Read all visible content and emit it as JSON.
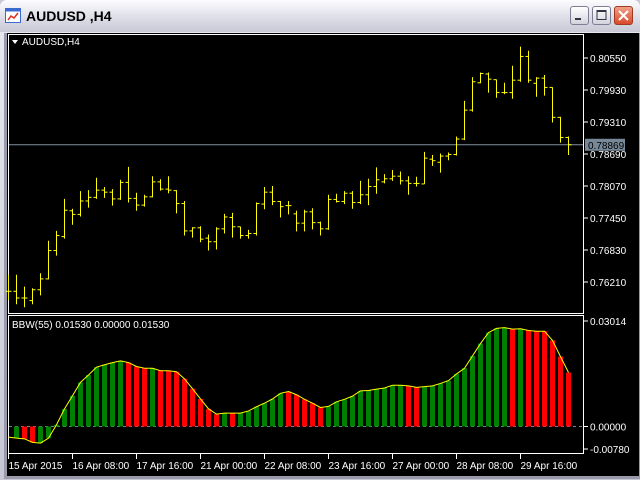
{
  "window": {
    "title": "AUDUSD ,H4"
  },
  "chart": {
    "symbol_label": "AUDUSD,H4",
    "price_axis": [
      "0.80550",
      "0.79930",
      "0.79310",
      "0.78690",
      "0.78070",
      "0.77450",
      "0.76830",
      "0.76210"
    ],
    "price_axis_values": [
      0.8055,
      0.7993,
      0.7931,
      0.7869,
      0.7807,
      0.7745,
      0.7683,
      0.7621
    ],
    "current_price": "0.78869",
    "current_price_value": 0.78869,
    "time_axis": [
      "15 Apr 2015",
      "16 Apr 08:00",
      "17 Apr 16:00",
      "21 Apr 00:00",
      "22 Apr 08:00",
      "23 Apr 16:00",
      "27 Apr 00:00",
      "28 Apr 08:00",
      "29 Apr 16:00"
    ],
    "colors": {
      "bars": "#ffff00",
      "up": "#008000",
      "down": "#ff0000",
      "line": "#ffff00",
      "price_line": "#8090a0"
    },
    "ohlc": [
      [
        0.7603,
        0.7635,
        0.7586,
        0.7603
      ],
      [
        0.7603,
        0.7635,
        0.7578,
        0.759
      ],
      [
        0.759,
        0.7612,
        0.7572,
        0.759
      ],
      [
        0.7585,
        0.7609,
        0.7578,
        0.7606
      ],
      [
        0.7606,
        0.7638,
        0.7595,
        0.7627
      ],
      [
        0.7627,
        0.7701,
        0.7626,
        0.7682
      ],
      [
        0.7682,
        0.772,
        0.7672,
        0.7711
      ],
      [
        0.7709,
        0.7782,
        0.7705,
        0.776
      ],
      [
        0.7759,
        0.7763,
        0.7732,
        0.7752
      ],
      [
        0.7752,
        0.7797,
        0.7748,
        0.7778
      ],
      [
        0.7778,
        0.7799,
        0.7765,
        0.7785
      ],
      [
        0.7785,
        0.7823,
        0.7782,
        0.7799
      ],
      [
        0.7799,
        0.7805,
        0.7784,
        0.7795
      ],
      [
        0.7795,
        0.7801,
        0.7769,
        0.7782
      ],
      [
        0.7782,
        0.7819,
        0.778,
        0.7814
      ],
      [
        0.7814,
        0.7844,
        0.7775,
        0.7783
      ],
      [
        0.7783,
        0.7794,
        0.7759,
        0.777
      ],
      [
        0.777,
        0.779,
        0.7767,
        0.7786
      ],
      [
        0.7786,
        0.7826,
        0.7785,
        0.7815
      ],
      [
        0.7815,
        0.782,
        0.7798,
        0.7801
      ],
      [
        0.7801,
        0.7826,
        0.7793,
        0.7799
      ],
      [
        0.7798,
        0.7799,
        0.7754,
        0.7773
      ],
      [
        0.7773,
        0.7778,
        0.7711,
        0.772
      ],
      [
        0.772,
        0.7727,
        0.7707,
        0.7726
      ],
      [
        0.7726,
        0.7729,
        0.7698,
        0.7704
      ],
      [
        0.7706,
        0.7713,
        0.7682,
        0.7699
      ],
      [
        0.7699,
        0.7727,
        0.7684,
        0.7724
      ],
      [
        0.7724,
        0.7753,
        0.7715,
        0.7747
      ],
      [
        0.7746,
        0.7755,
        0.7707,
        0.7728
      ],
      [
        0.7728,
        0.7728,
        0.7705,
        0.7711
      ],
      [
        0.7711,
        0.7722,
        0.7705,
        0.7715
      ],
      [
        0.7715,
        0.7775,
        0.7711,
        0.7773
      ],
      [
        0.7772,
        0.7805,
        0.7762,
        0.7795
      ],
      [
        0.7795,
        0.7807,
        0.777,
        0.7777
      ],
      [
        0.7777,
        0.7778,
        0.7746,
        0.7767
      ],
      [
        0.7769,
        0.7778,
        0.7752,
        0.7769
      ],
      [
        0.7753,
        0.7759,
        0.7719,
        0.7735
      ],
      [
        0.7735,
        0.7761,
        0.7719,
        0.7757
      ],
      [
        0.7757,
        0.7764,
        0.7723,
        0.7736
      ],
      [
        0.7736,
        0.7738,
        0.7711,
        0.7724
      ],
      [
        0.7724,
        0.779,
        0.7722,
        0.7781
      ],
      [
        0.7781,
        0.7792,
        0.7775,
        0.7777
      ],
      [
        0.7777,
        0.7797,
        0.7772,
        0.7793
      ],
      [
        0.7793,
        0.7797,
        0.7763,
        0.7775
      ],
      [
        0.7775,
        0.7817,
        0.7772,
        0.779
      ],
      [
        0.779,
        0.7821,
        0.777,
        0.7806
      ],
      [
        0.7806,
        0.7843,
        0.7792,
        0.7819
      ],
      [
        0.7815,
        0.783,
        0.7812,
        0.7821
      ],
      [
        0.7821,
        0.7838,
        0.7817,
        0.7826
      ],
      [
        0.7826,
        0.7835,
        0.781,
        0.7817
      ],
      [
        0.7817,
        0.7826,
        0.779,
        0.7812
      ],
      [
        0.7812,
        0.7825,
        0.7806,
        0.7812
      ],
      [
        0.7811,
        0.7873,
        0.7811,
        0.7861
      ],
      [
        0.7859,
        0.7867,
        0.7846,
        0.7856
      ],
      [
        0.7853,
        0.787,
        0.7833,
        0.7865
      ],
      [
        0.7865,
        0.7872,
        0.7857,
        0.7868
      ],
      [
        0.7868,
        0.7903,
        0.7866,
        0.7898
      ],
      [
        0.7898,
        0.7972,
        0.7896,
        0.7954
      ],
      [
        0.7954,
        0.8018,
        0.7951,
        0.8009
      ],
      [
        0.8007,
        0.8027,
        0.8006,
        0.8025
      ],
      [
        0.8024,
        0.8027,
        0.7988,
        0.8014
      ],
      [
        0.8013,
        0.8013,
        0.7978,
        0.7988
      ],
      [
        0.7988,
        0.8007,
        0.7985,
        0.7988
      ],
      [
        0.7988,
        0.804,
        0.7976,
        0.8012
      ],
      [
        0.8012,
        0.8077,
        0.8009,
        0.8058
      ],
      [
        0.8058,
        0.8069,
        0.8007,
        0.8012
      ],
      [
        0.8006,
        0.8018,
        0.798,
        0.8016
      ],
      [
        0.8016,
        0.8022,
        0.7982,
        0.7998
      ],
      [
        0.7998,
        0.7998,
        0.793,
        0.794
      ],
      [
        0.794,
        0.7941,
        0.7891,
        0.7901
      ],
      [
        0.7901,
        0.7903,
        0.7867,
        0.7887
      ]
    ]
  },
  "indicator": {
    "label": "BBW(55) 0.01530 0.00000 0.01530",
    "axis": [
      "0.03014",
      "0.00000",
      "-0.00780"
    ],
    "axis_values": [
      0.03014,
      0,
      -0.0078
    ],
    "values": [
      -0.003,
      -0.0033,
      -0.0035,
      -0.0045,
      -0.0047,
      -0.0033,
      0.0005,
      0.005,
      0.0087,
      0.0125,
      0.0146,
      0.0168,
      0.0175,
      0.0181,
      0.0186,
      0.0181,
      0.017,
      0.0165,
      0.0165,
      0.0158,
      0.0158,
      0.0155,
      0.0135,
      0.0107,
      0.0078,
      0.005,
      0.0035,
      0.0038,
      0.0038,
      0.0038,
      0.0044,
      0.0056,
      0.0066,
      0.0078,
      0.0094,
      0.0099,
      0.009,
      0.0077,
      0.0066,
      0.0054,
      0.0057,
      0.007,
      0.0077,
      0.0086,
      0.0101,
      0.0102,
      0.0106,
      0.0109,
      0.0117,
      0.0117,
      0.0115,
      0.0111,
      0.0113,
      0.0115,
      0.0122,
      0.013,
      0.0149,
      0.0165,
      0.02,
      0.0235,
      0.0266,
      0.0278,
      0.028,
      0.0276,
      0.0277,
      0.0272,
      0.027,
      0.027,
      0.0244,
      0.0198,
      0.0153
    ],
    "colors": "GGRRGGGGGGGGGGGRRRGRRRRRRRRGRGGGGGGRRRRRGGGGGGGGGGRRGGGGGGGGGGGRGRRRRRR"
  }
}
